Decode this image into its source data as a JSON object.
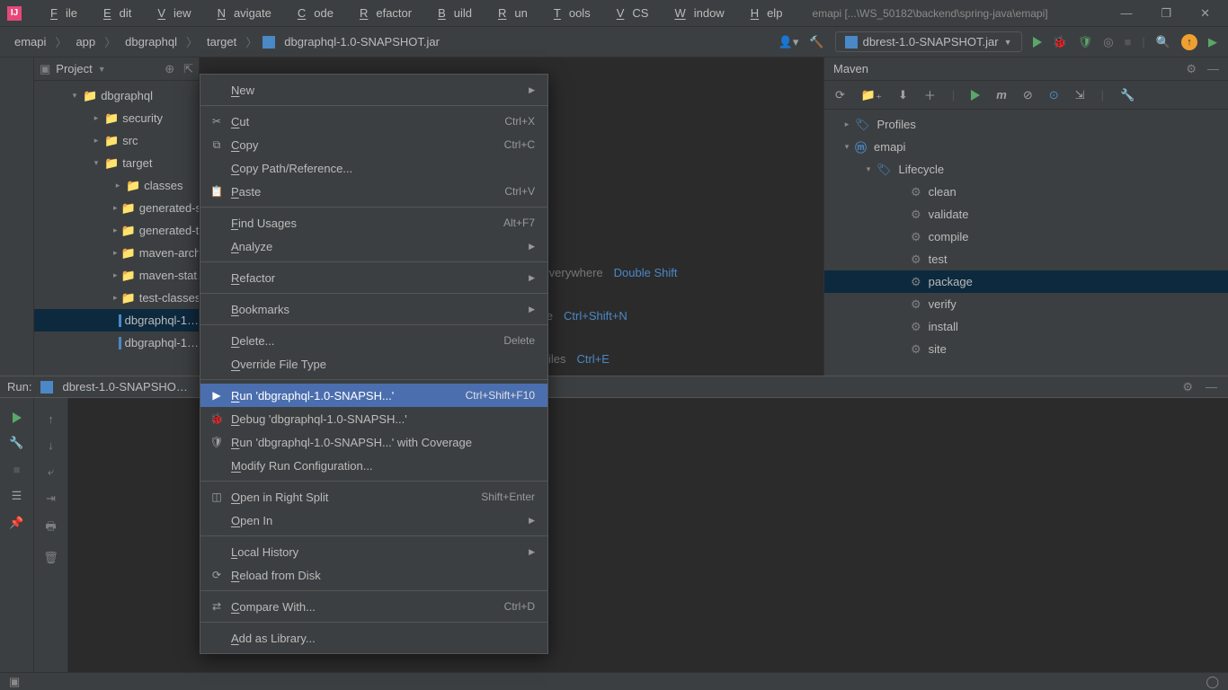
{
  "titlebar": {
    "app": "IJ",
    "menus": [
      "File",
      "Edit",
      "View",
      "Navigate",
      "Code",
      "Refactor",
      "Build",
      "Run",
      "Tools",
      "VCS",
      "Window",
      "Help"
    ],
    "title": "emapi [...\\WS_50182\\backend\\spring-java\\emapi]"
  },
  "breadcrumbs": [
    "emapi",
    "app",
    "dbgraphql",
    "target",
    "dbgraphql-1.0-SNAPSHOT.jar"
  ],
  "run_config": "dbrest-1.0-SNAPSHOT.jar",
  "project": {
    "title": "Project",
    "items": [
      {
        "indent": 40,
        "chev": "v",
        "icon": "fld-y",
        "label": "dbgraphql"
      },
      {
        "indent": 64,
        "chev": ">",
        "icon": "fld",
        "label": "security"
      },
      {
        "indent": 64,
        "chev": ">",
        "icon": "fld",
        "label": "src"
      },
      {
        "indent": 64,
        "chev": "v",
        "icon": "fld-y",
        "label": "target"
      },
      {
        "indent": 88,
        "chev": ">",
        "icon": "fld-y",
        "label": "classes"
      },
      {
        "indent": 88,
        "chev": ">",
        "icon": "fld-y",
        "label": "generated-s…"
      },
      {
        "indent": 88,
        "chev": ">",
        "icon": "fld-y",
        "label": "generated-t…"
      },
      {
        "indent": 88,
        "chev": ">",
        "icon": "fld-y",
        "label": "maven-arch…"
      },
      {
        "indent": 88,
        "chev": ">",
        "icon": "fld-y",
        "label": "maven-stat…"
      },
      {
        "indent": 88,
        "chev": ">",
        "icon": "fld-y",
        "label": "test-classes"
      },
      {
        "indent": 88,
        "chev": "",
        "icon": "jar",
        "label": "dbgraphql-1…",
        "sel": true
      },
      {
        "indent": 88,
        "chev": "",
        "icon": "jar",
        "label": "dbgraphql-1…"
      }
    ]
  },
  "placeholder": {
    "l1a": "Everywhere",
    "l1b": "Double Shift",
    "l2a": "ile",
    "l2b": "Ctrl+Shift+N",
    "l3a": "Files",
    "l3b": "Ctrl+E"
  },
  "maven": {
    "title": "Maven",
    "items": [
      {
        "indent": 10,
        "chev": ">",
        "icon": "flag",
        "label": "Profiles"
      },
      {
        "indent": 10,
        "chev": "v",
        "icon": "m",
        "label": "emapi"
      },
      {
        "indent": 34,
        "chev": "v",
        "icon": "flag",
        "label": "Lifecycle"
      },
      {
        "indent": 72,
        "chev": "",
        "icon": "gear",
        "label": "clean"
      },
      {
        "indent": 72,
        "chev": "",
        "icon": "gear",
        "label": "validate"
      },
      {
        "indent": 72,
        "chev": "",
        "icon": "gear",
        "label": "compile"
      },
      {
        "indent": 72,
        "chev": "",
        "icon": "gear",
        "label": "test"
      },
      {
        "indent": 72,
        "chev": "",
        "icon": "gear",
        "label": "package",
        "sel": true
      },
      {
        "indent": 72,
        "chev": "",
        "icon": "gear",
        "label": "verify"
      },
      {
        "indent": 72,
        "chev": "",
        "icon": "gear",
        "label": "install"
      },
      {
        "indent": 72,
        "chev": "",
        "icon": "gear",
        "label": "site"
      }
    ]
  },
  "run_tab": {
    "label": "Run:",
    "config": "dbrest-1.0-SNAPSHO…"
  },
  "ctx": {
    "groups": [
      [
        {
          "l": "New",
          "sub": true
        }
      ],
      [
        {
          "l": "Cut",
          "kb": "Ctrl+X",
          "ic": "✂"
        },
        {
          "l": "Copy",
          "kb": "Ctrl+C",
          "ic": "⧉"
        },
        {
          "l": "Copy Path/Reference..."
        },
        {
          "l": "Paste",
          "kb": "Ctrl+V",
          "ic": "📋"
        }
      ],
      [
        {
          "l": "Find Usages",
          "kb": "Alt+F7"
        },
        {
          "l": "Analyze",
          "sub": true
        }
      ],
      [
        {
          "l": "Refactor",
          "sub": true
        }
      ],
      [
        {
          "l": "Bookmarks",
          "sub": true
        }
      ],
      [
        {
          "l": "Delete...",
          "kb": "Delete"
        },
        {
          "l": "Override File Type"
        }
      ],
      [
        {
          "l": "Run 'dbgraphql-1.0-SNAPSH...'",
          "kb": "Ctrl+Shift+F10",
          "ic": "▶",
          "hl": true
        },
        {
          "l": "Debug 'dbgraphql-1.0-SNAPSH...'",
          "ic": "🐞"
        },
        {
          "l": "Run 'dbgraphql-1.0-SNAPSH...' with Coverage",
          "ic": "🛡"
        },
        {
          "l": "Modify Run Configuration..."
        }
      ],
      [
        {
          "l": "Open in Right Split",
          "kb": "Shift+Enter",
          "ic": "◫"
        },
        {
          "l": "Open In",
          "sub": true
        }
      ],
      [
        {
          "l": "Local History",
          "sub": true
        },
        {
          "l": "Reload from Disk",
          "ic": "⟳"
        }
      ],
      [
        {
          "l": "Compare With...",
          "kb": "Ctrl+D",
          "ic": "⇄"
        }
      ],
      [
        {
          "l": "Add as Library..."
        }
      ]
    ]
  }
}
